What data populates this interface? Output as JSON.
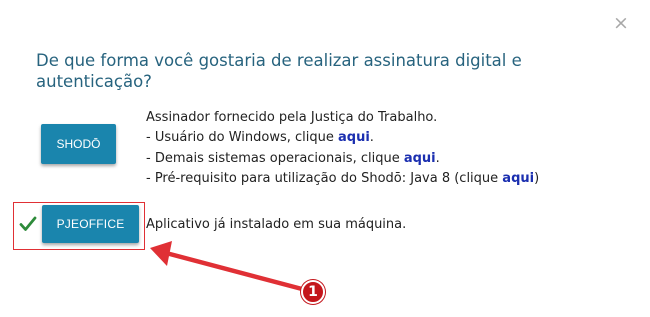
{
  "dialog": {
    "close_label": "×",
    "title": "De que forma você gostaria de realizar assinatura digital e autenticação?"
  },
  "shodo": {
    "button_label": "SHODŌ",
    "description": "Assinador fornecido pela Justiça do Trabalho.",
    "windows_text": "- Usuário do Windows, clique ",
    "windows_link": "aqui",
    "windows_suffix": ".",
    "other_os_text": "- Demais sistemas operacionais, clique ",
    "other_os_link": "aqui",
    "other_os_suffix": ".",
    "prereq_text": "- Pré-requisito para utilização do Shodō: Java 8 (clique ",
    "prereq_link": "aqui",
    "prereq_suffix": ")"
  },
  "pjeoffice": {
    "button_label": "PJEOFFICE",
    "status_text": "Aplicativo já instalado em sua máquina.",
    "status_icon": "checkmark-icon"
  },
  "annotation": {
    "step_number": "1",
    "color": "#e03035"
  },
  "colors": {
    "title": "#27637e",
    "button": "#1a85ad",
    "link": "#1b2fb0",
    "check": "#2e8b3a"
  }
}
